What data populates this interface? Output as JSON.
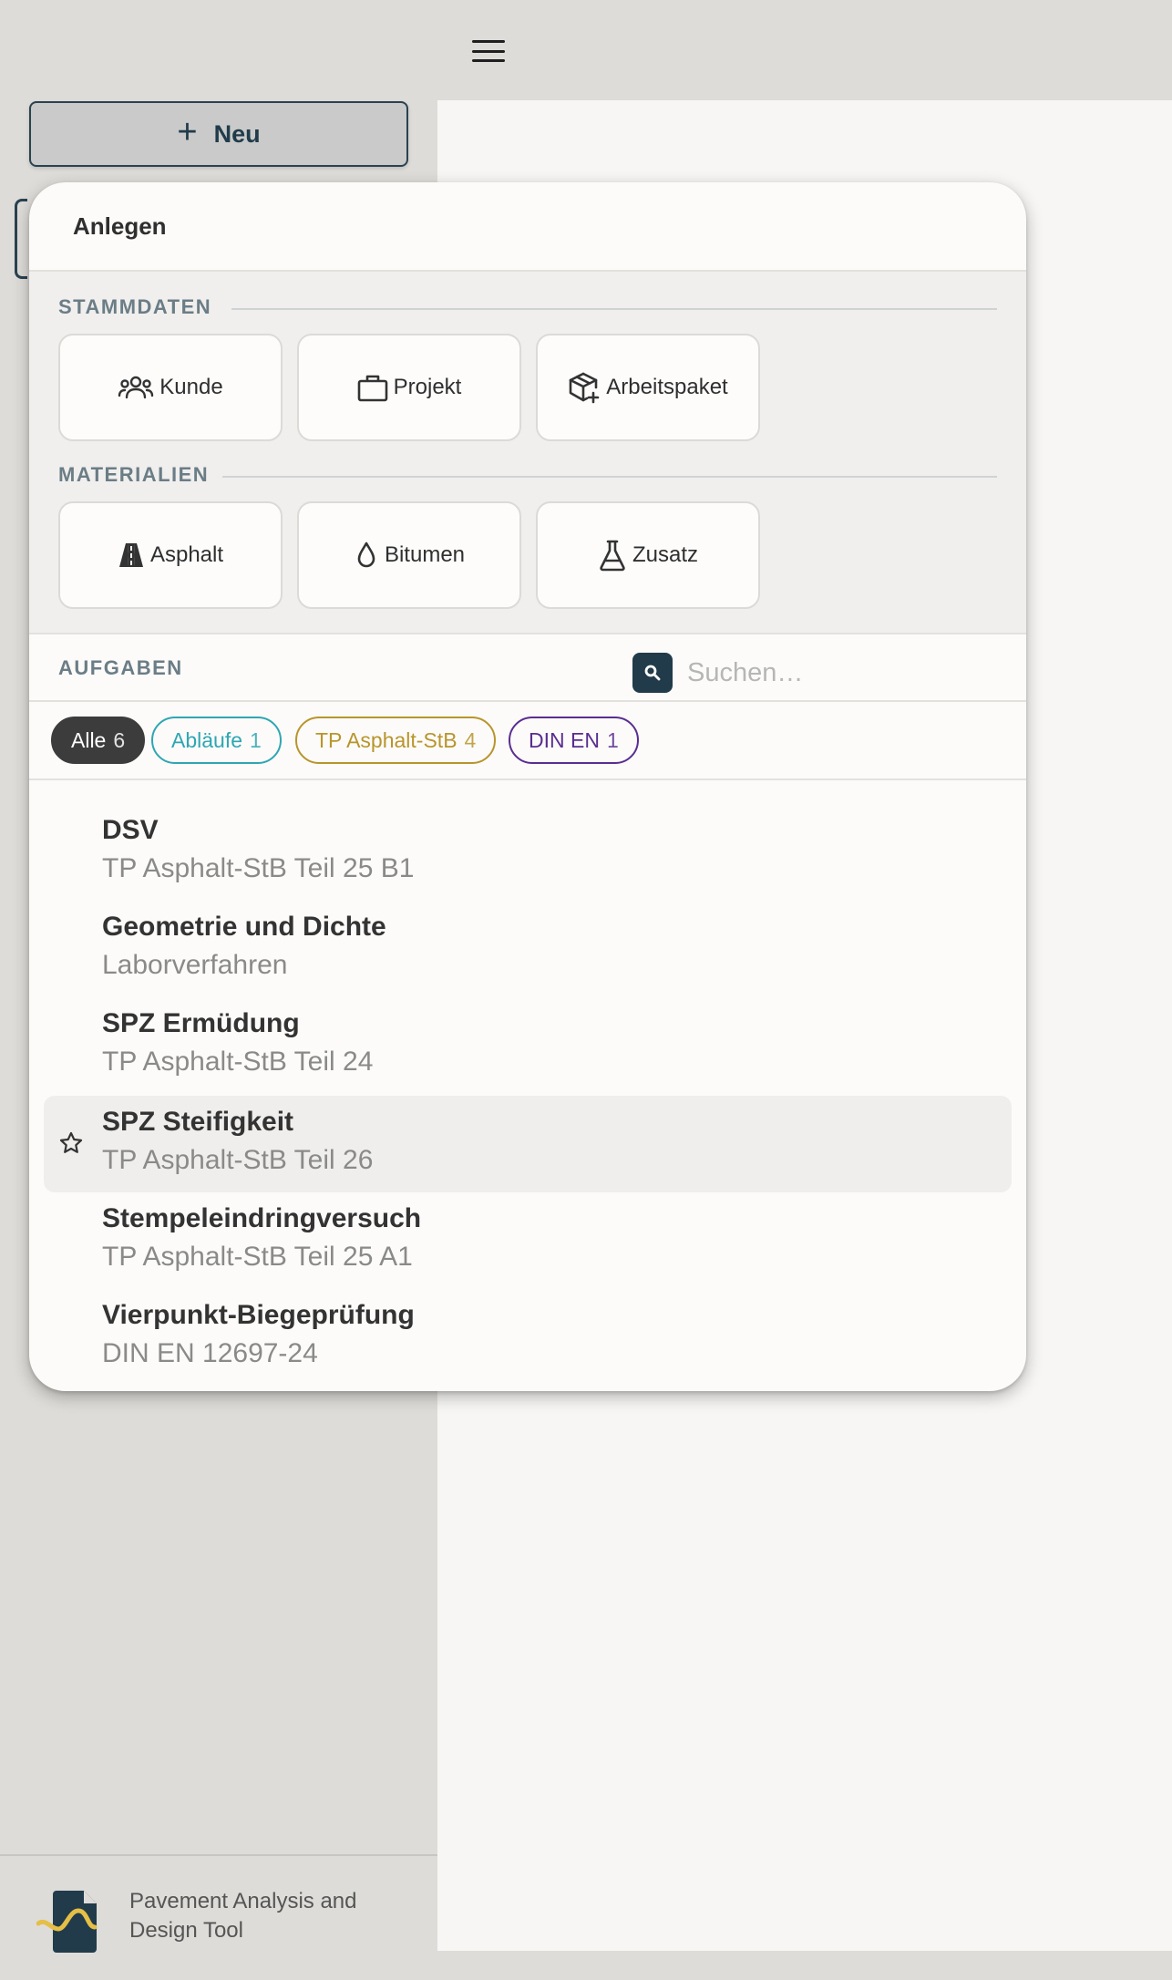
{
  "header": {
    "menu_icon": "hamburger-menu-icon"
  },
  "sidebar": {
    "new_button": {
      "label": "Neu",
      "icon": "plus-icon"
    },
    "brand": {
      "line1": "Pavement Analysis and",
      "line2": "Design Tool"
    }
  },
  "popup": {
    "title": "Anlegen",
    "stammdaten": {
      "label": "STAMMDATEN",
      "tiles": [
        {
          "label": "Kunde",
          "icon": "users-icon"
        },
        {
          "label": "Projekt",
          "icon": "briefcase-icon"
        },
        {
          "label": "Arbeitspaket",
          "icon": "package-plus-icon"
        }
      ]
    },
    "materialien": {
      "label": "MATERIALIEN",
      "tiles": [
        {
          "label": "Asphalt",
          "icon": "road-icon"
        },
        {
          "label": "Bitumen",
          "icon": "droplet-icon"
        },
        {
          "label": "Zusatz",
          "icon": "flask-icon"
        }
      ]
    },
    "aufgaben": {
      "label": "AUFGABEN",
      "search_placeholder": "Suchen…",
      "filters": [
        {
          "label": "Alle",
          "count": "6",
          "color": "#3c3c3c",
          "active": true
        },
        {
          "label": "Abläufe",
          "count": "1",
          "color": "#2fa6b3",
          "active": false
        },
        {
          "label": "TP Asphalt-StB",
          "count": "4",
          "color": "#b8952c",
          "active": false
        },
        {
          "label": "DIN EN",
          "count": "1",
          "color": "#5a2d91",
          "active": false
        }
      ],
      "tasks": [
        {
          "title": "DSV",
          "subtitle": "TP Asphalt-StB Teil 25 B1"
        },
        {
          "title": "Geometrie und Dichte",
          "subtitle": "Laborverfahren"
        },
        {
          "title": "SPZ Ermüdung",
          "subtitle": "TP Asphalt-StB Teil 24"
        },
        {
          "title": "SPZ Steifigkeit",
          "subtitle": "TP Asphalt-StB Teil 26",
          "highlighted": true
        },
        {
          "title": "Stempeleindringversuch",
          "subtitle": "TP Asphalt-StB Teil 25 A1"
        },
        {
          "title": "Vierpunkt-Biegeprüfung",
          "subtitle": "DIN EN 12697-24"
        }
      ]
    }
  },
  "colors": {
    "accent": "#213b4a",
    "background": "#dedcd8",
    "logo_accent": "#e5bf46"
  }
}
